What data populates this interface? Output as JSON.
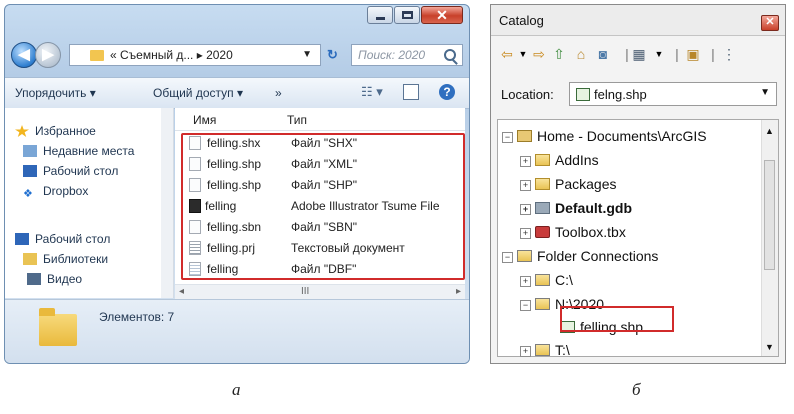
{
  "explorer": {
    "address_path": "« Съемный д... ▸ 2020",
    "search_placeholder": "Поиск: 2020",
    "toolbar": {
      "organize": "Упорядочить ▾",
      "share": "Общий доступ ▾",
      "more": "»"
    },
    "nav": [
      {
        "label": "Избранное",
        "icon": "star-icon"
      },
      {
        "label": "Недавние места",
        "icon": "recent-places-icon"
      },
      {
        "label": "Рабочий стол",
        "icon": "desktop-icon"
      },
      {
        "label": "Dropbox",
        "icon": "dropbox-icon"
      },
      {
        "label": "Рабочий стол",
        "icon": "desktop-icon"
      },
      {
        "label": "Библиотеки",
        "icon": "libraries-icon"
      },
      {
        "label": "Видео",
        "icon": "video-icon"
      }
    ],
    "columns": {
      "name": "Имя",
      "type": "Тип"
    },
    "files": [
      {
        "name": "felling.shx",
        "type": "Файл \"SHX\""
      },
      {
        "name": "felling.shp",
        "type": "Файл \"XML\""
      },
      {
        "name": "felling.shp",
        "type": "Файл \"SHP\""
      },
      {
        "name": "felling",
        "type": "Adobe Illustrator Tsume File"
      },
      {
        "name": "felling.sbn",
        "type": "Файл \"SBN\""
      },
      {
        "name": "felling.prj",
        "type": "Текстовый документ"
      },
      {
        "name": "felling",
        "type": "Файл \"DBF\""
      }
    ],
    "hscroll_mark": "III",
    "status_count": "Элементов: 7"
  },
  "catalog": {
    "title": "Catalog",
    "location_label": "Location:",
    "location_value": "felng.shp",
    "tree": {
      "home": "Home - Documents\\ArcGIS",
      "addins": "AddIns",
      "packages": "Packages",
      "default_gdb": "Default.gdb",
      "toolbox": "Toolbox.tbx",
      "folder_connections": "Folder Connections",
      "c_drive": "C:\\",
      "n_2020": "N:\\2020",
      "felling_shp": "felling.shp",
      "t_drive": "T:\\"
    }
  },
  "captions": {
    "left": "а",
    "right": "б"
  },
  "colors": {
    "highlight": "#d12b2b",
    "win7_frame": "#b4cce6"
  }
}
